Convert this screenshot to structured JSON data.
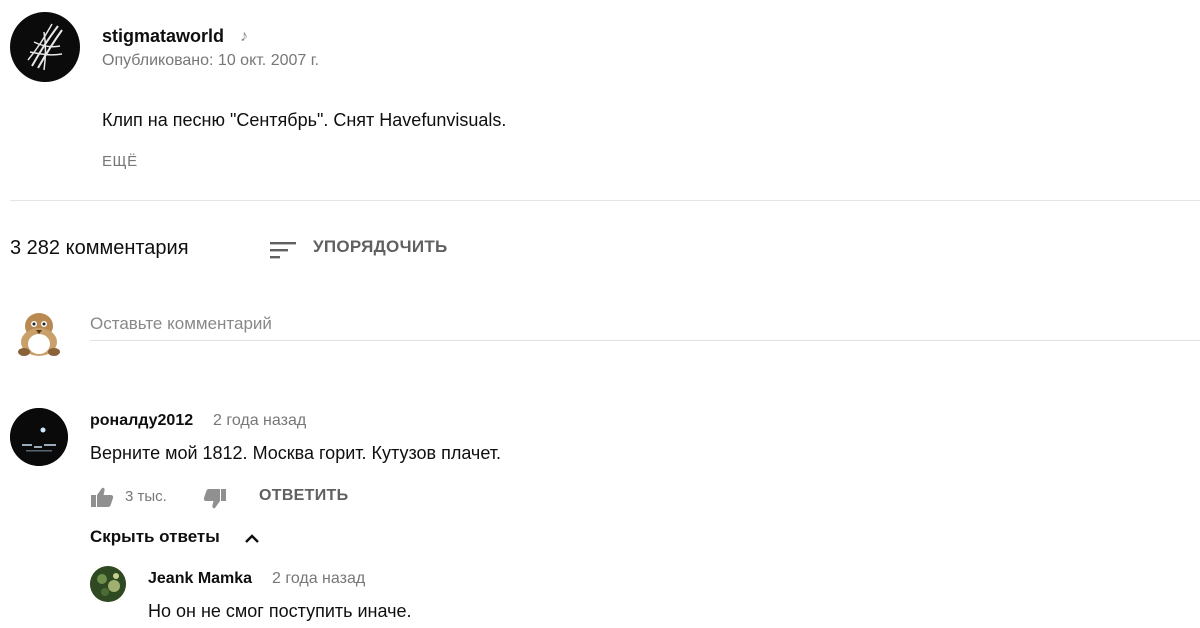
{
  "video_meta": {
    "channel_name": "stigmataworld",
    "music_icon": "music-note-icon",
    "published": "Опубликовано: 10 окт. 2007 г.",
    "description": "Клип на песню \"Сентябрь\". Снят Havefunvisuals.",
    "more_label": "ЕЩЁ"
  },
  "comments_header": {
    "count_label": "3 282 комментария",
    "sort_icon": "sort-icon",
    "sort_label": "УПОРЯДОЧИТЬ"
  },
  "add_comment": {
    "placeholder": "Оставьте комментарий"
  },
  "comment": {
    "author": "роналду2012",
    "time": "2 года назад",
    "text": "Верните мой 1812. Москва горит. Кутузов плачет.",
    "like_count": "3 тыс.",
    "reply_label": "ОТВЕТИТЬ",
    "hide_replies_label": "Скрыть ответы"
  },
  "reply": {
    "author": "Jeank Mamka",
    "time": "2 года назад",
    "text": "Но он не смог поступить иначе."
  },
  "colors": {
    "text_primary": "#0f0f0f",
    "text_secondary": "#777777",
    "button_gray": "#606060",
    "divider": "#e5e5e5"
  }
}
